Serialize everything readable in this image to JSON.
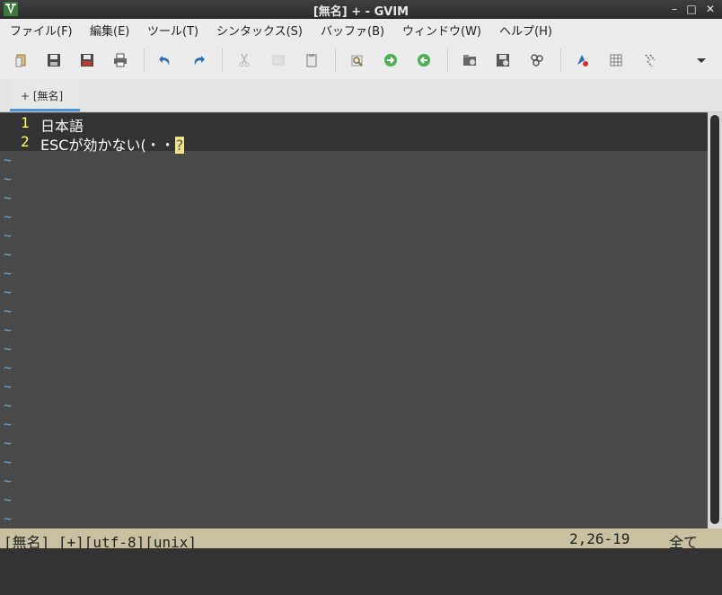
{
  "window": {
    "title": "[無名] + - GVIM",
    "minimize": "–",
    "maximize": "□",
    "close": "✕"
  },
  "menu": [
    "ファイル(F)",
    "編集(E)",
    "ツール(T)",
    "シンタックス(S)",
    "バッファ(B)",
    "ウィンドウ(W)",
    "ヘルプ(H)"
  ],
  "toolbar": {
    "icons": [
      "open-icon",
      "save-icon",
      "save-all-icon",
      "print-icon",
      "undo-icon",
      "redo-icon",
      "cut-icon",
      "copy-icon",
      "paste-icon",
      "find-replace-icon",
      "find-next-icon",
      "find-prev-icon",
      "load-session-icon",
      "save-session-icon",
      "run-script-icon",
      "make-icon",
      "shell-icon",
      "tags-icon",
      "overflow-chevron-icon"
    ]
  },
  "tab": {
    "label": "+ [無名]"
  },
  "editor": {
    "lines": [
      {
        "num": "1",
        "text": "日本語"
      },
      {
        "num": "2",
        "text": "ESCが効かない(・・",
        "cursor_char": "?"
      }
    ],
    "tilde": "~",
    "colors": {
      "background": "#4a4a4a",
      "line_bg": "#333333",
      "line_number": "#ffff55",
      "tilde": "#6fa8dc",
      "cursor": "#f0e28a"
    }
  },
  "status": {
    "left": "[無名] [+][utf-8][unix]",
    "position": "2,26-19",
    "scroll": "全て"
  }
}
